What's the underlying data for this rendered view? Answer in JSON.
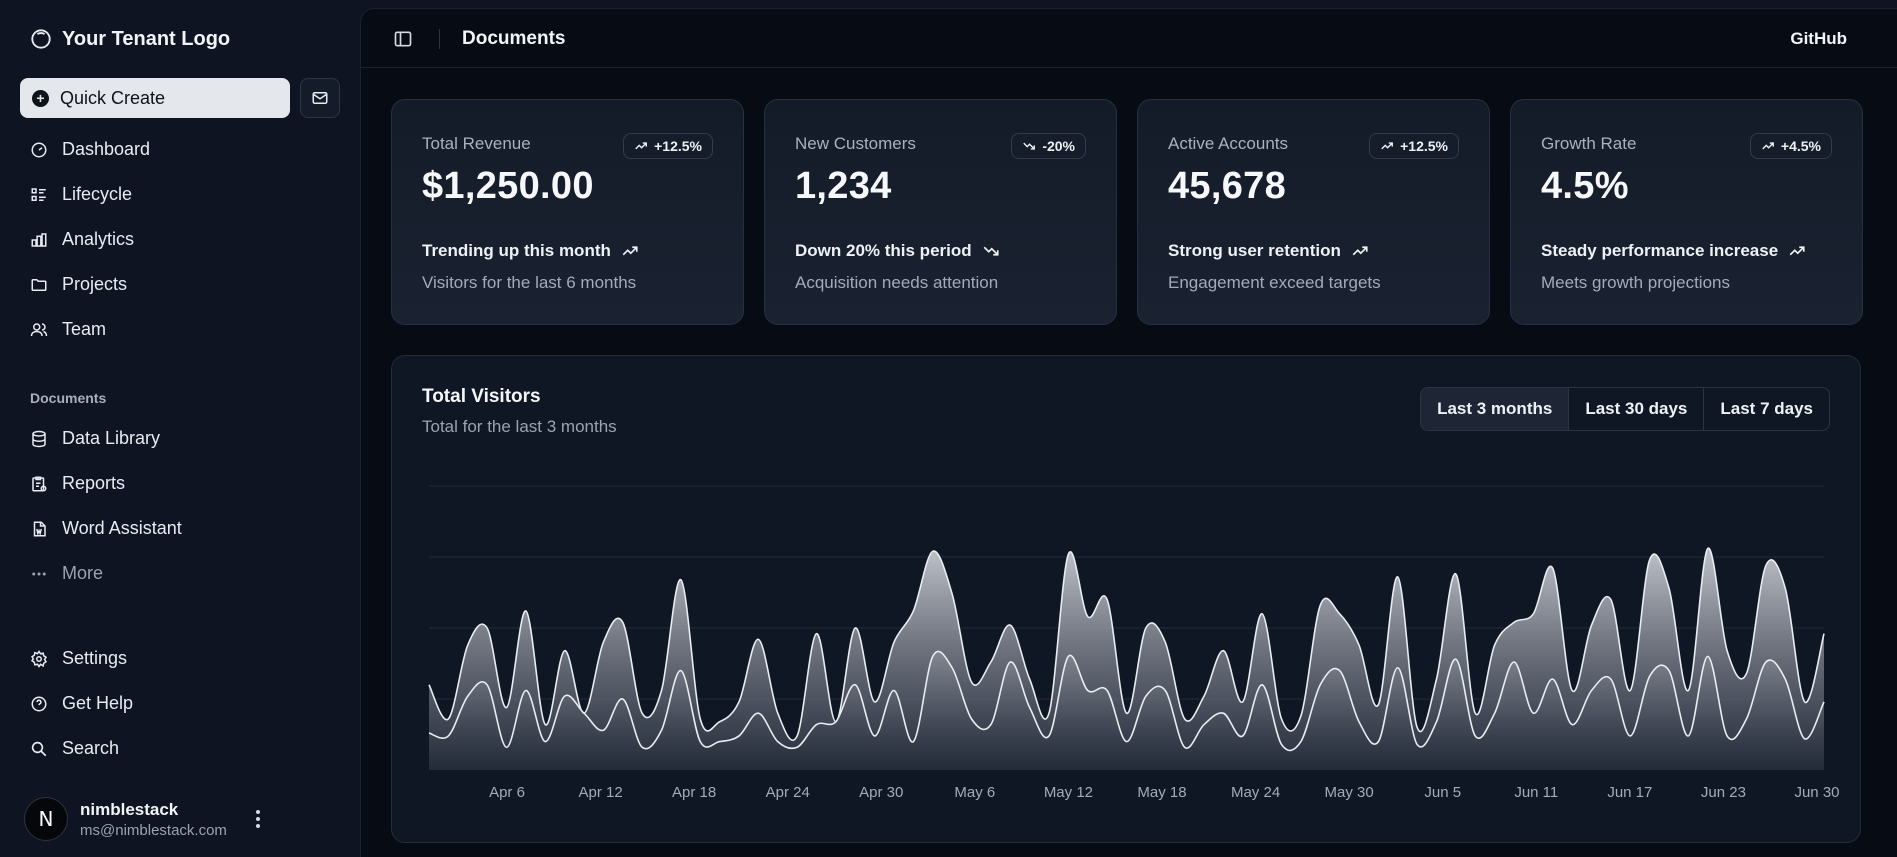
{
  "brand": {
    "name": "Your Tenant Logo"
  },
  "sidebar": {
    "quick_create": "Quick Create",
    "nav": [
      {
        "label": "Dashboard",
        "icon": "gauge-icon"
      },
      {
        "label": "Lifecycle",
        "icon": "list-details-icon"
      },
      {
        "label": "Analytics",
        "icon": "chart-bar-icon"
      },
      {
        "label": "Projects",
        "icon": "folder-icon"
      },
      {
        "label": "Team",
        "icon": "users-icon"
      }
    ],
    "documents_label": "Documents",
    "documents": [
      {
        "label": "Data Library",
        "icon": "database-icon"
      },
      {
        "label": "Reports",
        "icon": "report-icon"
      },
      {
        "label": "Word Assistant",
        "icon": "file-word-icon"
      },
      {
        "label": "More",
        "icon": "dots-icon"
      }
    ],
    "secondary": [
      {
        "label": "Settings",
        "icon": "settings-icon"
      },
      {
        "label": "Get Help",
        "icon": "help-icon"
      },
      {
        "label": "Search",
        "icon": "search-icon"
      }
    ],
    "user": {
      "initial": "N",
      "name": "nimblestack",
      "email": "ms@nimblestack.com"
    }
  },
  "header": {
    "title": "Documents",
    "github": "GitHub"
  },
  "cards": [
    {
      "label": "Total Revenue",
      "badge": "+12.5%",
      "direction": "up",
      "value": "$1,250.00",
      "trend": "Trending up this month",
      "sub": "Visitors for the last 6 months"
    },
    {
      "label": "New Customers",
      "badge": "-20%",
      "direction": "down",
      "value": "1,234",
      "trend": "Down 20% this period",
      "sub": "Acquisition needs attention"
    },
    {
      "label": "Active Accounts",
      "badge": "+12.5%",
      "direction": "up",
      "value": "45,678",
      "trend": "Strong user retention",
      "sub": "Engagement exceed targets"
    },
    {
      "label": "Growth Rate",
      "badge": "+4.5%",
      "direction": "up",
      "value": "4.5%",
      "trend": "Steady performance increase",
      "sub": "Meets growth projections"
    }
  ],
  "chart_card": {
    "title": "Total Visitors",
    "subtitle": "Total for the last 3 months",
    "ranges": [
      "Last 3 months",
      "Last 30 days",
      "Last 7 days"
    ],
    "selected_range": "Last 3 months"
  },
  "chart_data": {
    "type": "area",
    "xlabel": "",
    "ylabel": "",
    "grid": true,
    "x_ticks": [
      "Apr 6",
      "Apr 12",
      "Apr 18",
      "Apr 24",
      "Apr 30",
      "May 6",
      "May 12",
      "May 18",
      "May 24",
      "May 30",
      "Jun 5",
      "Jun 11",
      "Jun 17",
      "Jun 23",
      "Jun 30"
    ],
    "x_start": "Apr 1",
    "x_end": "Jun 30",
    "ylim": [
      0,
      100
    ],
    "series": [
      {
        "values": [
          30,
          18,
          44,
          50,
          22,
          56,
          16,
          42,
          20,
          45,
          52,
          20,
          28,
          67,
          18,
          17,
          24,
          46,
          20,
          12,
          48,
          17,
          50,
          24,
          45,
          56,
          77,
          62,
          31,
          38,
          51,
          32,
          20,
          76,
          54,
          60,
          20,
          50,
          45,
          18,
          26,
          42,
          24,
          55,
          18,
          19,
          58,
          55,
          44,
          23,
          68,
          15,
          32,
          69,
          20,
          44,
          52,
          55,
          71,
          28,
          51,
          60,
          28,
          74,
          64,
          28,
          78,
          42,
          34,
          72,
          64,
          24,
          48
        ]
      },
      {
        "values": [
          13,
          12,
          26,
          30,
          8,
          28,
          10,
          26,
          20,
          14,
          25,
          8,
          14,
          35,
          10,
          10,
          12,
          20,
          10,
          8,
          16,
          17,
          30,
          12,
          28,
          10,
          40,
          36,
          18,
          16,
          38,
          22,
          12,
          40,
          28,
          28,
          10,
          26,
          28,
          8,
          16,
          20,
          12,
          30,
          9,
          10,
          30,
          35,
          17,
          10,
          36,
          9,
          17,
          39,
          12,
          20,
          38,
          20,
          32,
          16,
          28,
          32,
          12,
          33,
          35,
          12,
          40,
          12,
          18,
          38,
          32,
          11,
          24
        ]
      }
    ]
  }
}
